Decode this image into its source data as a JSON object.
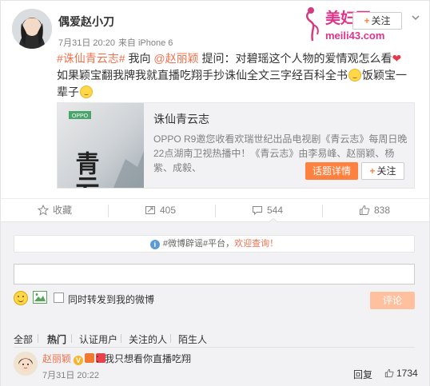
{
  "post": {
    "username": "偶爱赵小刀",
    "date": "7月31日 20:20",
    "source": "来自 iPhone 6",
    "follow_label": "关注",
    "logo_text": "美妇网",
    "logo_url": "meili43.com",
    "text_topic": "#诛仙青云志#",
    "text_1": " 我向 ",
    "text_mention": "@赵丽颖",
    "text_2": " 提问：对碧瑶这个人物的爱情观怎么看",
    "text_3": "如果颖宝翻我牌我就直播吃翔手抄诛仙全文三字经百科全书",
    "text_4": "饭颖宝一辈子"
  },
  "card": {
    "title": "诛仙青云志",
    "brand": "OPPO",
    "calligraphy": "青云志",
    "desc": "OPPO R9邀您收看欢瑞世纪出品电视剧《青云志》每周日晚22点湖南卫视热播中！《青云志》由李易峰、赵丽颖、杨紫、成毅、",
    "detail_label": "话题详情",
    "follow_label": "关注"
  },
  "actions": {
    "favorite_label": "收藏",
    "repost_count": "405",
    "comment_count": "544",
    "like_count": "838"
  },
  "comment_box": {
    "notice_prefix": "#微博辟谣#平台，",
    "notice_link": "欢迎查询！",
    "repost_label": "同时转发到我的微博",
    "submit_label": "评论"
  },
  "filters": {
    "all": "全部",
    "hot": "热门",
    "verified": "认证用户",
    "following": "关注的人",
    "strangers": "陌生人"
  },
  "comment": {
    "name": "赵丽颖",
    "text": "：我只想看你直播吃翔",
    "time": "7月31日 20:22",
    "reply_label": "回复",
    "like_count": "1734"
  }
}
